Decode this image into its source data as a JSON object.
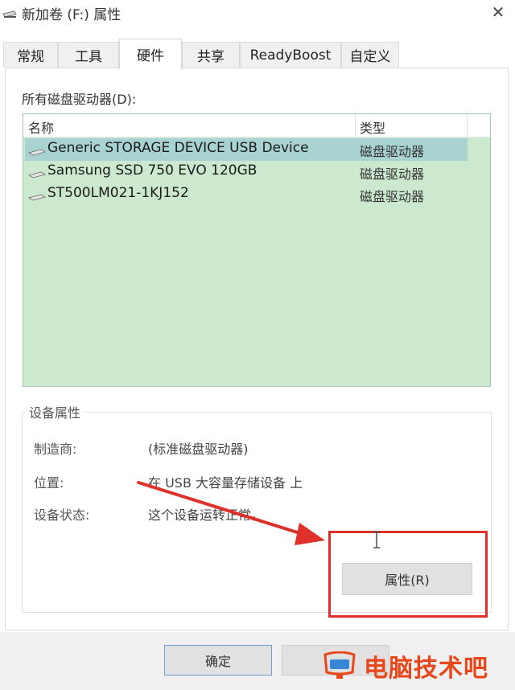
{
  "window": {
    "title": "新加卷 (F:) 属性",
    "close_glyph": "✕"
  },
  "tabs": [
    {
      "label": "常规"
    },
    {
      "label": "工具"
    },
    {
      "label": "硬件"
    },
    {
      "label": "共享"
    },
    {
      "label": "ReadyBoost"
    },
    {
      "label": "自定义"
    }
  ],
  "active_tab": "硬件",
  "device_list": {
    "label": "所有磁盘驱动器(D):",
    "columns": {
      "name": "名称",
      "type": "类型"
    },
    "rows": [
      {
        "name": "Generic STORAGE DEVICE USB Device",
        "type": "磁盘驱动器",
        "selected": true
      },
      {
        "name": "Samsung SSD 750 EVO 120GB",
        "type": "磁盘驱动器",
        "selected": false
      },
      {
        "name": "ST500LM021-1KJ152",
        "type": "磁盘驱动器",
        "selected": false
      }
    ]
  },
  "device_properties": {
    "title": "设备属性",
    "manufacturer_label": "制造商:",
    "manufacturer_value": "(标准磁盘驱动器)",
    "location_label": "位置:",
    "location_value": "在 USB 大容量存储设备 上",
    "status_label": "设备状态:",
    "status_value": "这个设备运转正常。",
    "properties_button": "属性(R)"
  },
  "footer": {
    "ok_label": "确定"
  },
  "watermark": {
    "text": "电脑技术吧"
  },
  "colors": {
    "list_background": "#cce8cf",
    "selected_row": "#a9d3d2",
    "annotation_red": "#e0302b",
    "watermark_orange": "#e8461b"
  }
}
